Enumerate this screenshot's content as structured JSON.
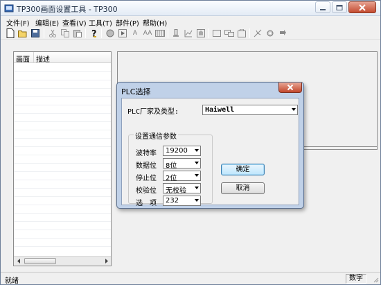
{
  "window": {
    "title": "TP300画面设置工具 - TP300"
  },
  "menu": [
    {
      "label": "文件(F)"
    },
    {
      "label": "编辑(E)"
    },
    {
      "label": "查看(V)"
    },
    {
      "label": "工具(T)"
    },
    {
      "label": "部件(P)"
    },
    {
      "label": "帮助(H)"
    }
  ],
  "toolbar": {
    "icons": [
      "new-file-icon",
      "open-folder-icon",
      "save-icon",
      "cut-icon",
      "copy-icon",
      "paste-icon",
      "help-icon",
      "circle-icon",
      "play-icon",
      "text-a-icon",
      "text-aa-icon",
      "grid-icon",
      "meter-icon",
      "trend-chart-icon",
      "alarm-icon",
      "rectangle-icon",
      "overlap-icon",
      "bitmap-icon",
      "recipe-icon",
      "settings-gear-icon",
      "download-arrow-icon"
    ],
    "text_a": "A",
    "text_aa": "AA"
  },
  "screen_list": {
    "columns": [
      "画面",
      "描述"
    ]
  },
  "status": {
    "ready": "就绪",
    "num": "数字"
  },
  "dialog": {
    "title": "PLC选择",
    "plc_label": "PLC厂家及类型:",
    "plc_value": "Haiwell",
    "group_title": "设置通信参数",
    "params": [
      {
        "label": "波特率",
        "value": "19200"
      },
      {
        "label": "数据位",
        "value": "8位"
      },
      {
        "label": "停止位",
        "value": "2位"
      },
      {
        "label": "校验位",
        "value": "无校验"
      },
      {
        "label": "选　项",
        "value": "232"
      }
    ],
    "ok": "确定",
    "cancel": "取消"
  }
}
